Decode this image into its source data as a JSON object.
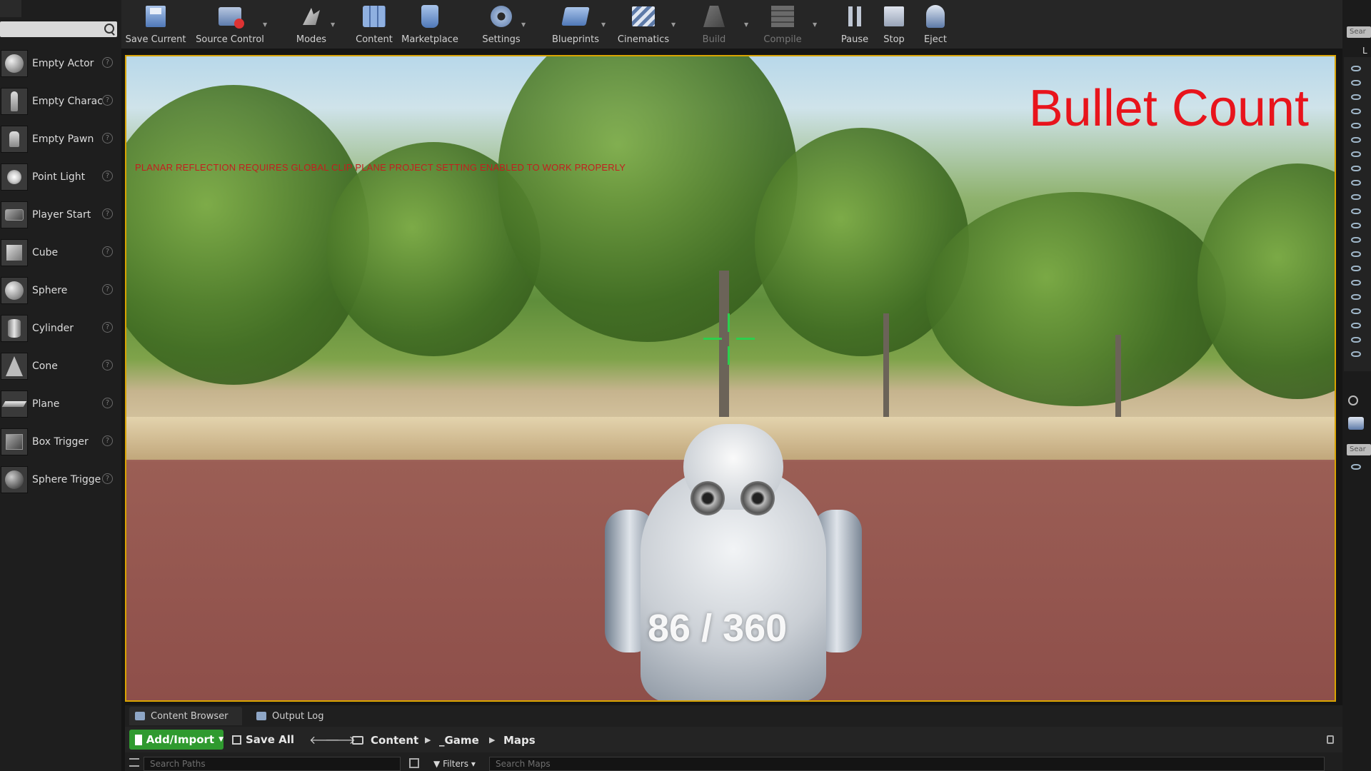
{
  "toolbar": {
    "buttons": [
      {
        "label": "Save Current",
        "icon": "save-icon"
      },
      {
        "label": "Source Control",
        "icon": "source-control-icon"
      },
      {
        "label": "Modes",
        "icon": "modes-icon"
      },
      {
        "label": "Content",
        "icon": "content-icon"
      },
      {
        "label": "Marketplace",
        "icon": "marketplace-icon"
      },
      {
        "label": "Settings",
        "icon": "settings-icon"
      },
      {
        "label": "Blueprints",
        "icon": "blueprints-icon"
      },
      {
        "label": "Cinematics",
        "icon": "cinematics-icon"
      },
      {
        "label": "Build",
        "icon": "build-icon"
      },
      {
        "label": "Compile",
        "icon": "compile-icon"
      },
      {
        "label": "Pause",
        "icon": "pause-icon"
      },
      {
        "label": "Stop",
        "icon": "stop-icon"
      },
      {
        "label": "Eject",
        "icon": "eject-icon"
      }
    ]
  },
  "place_actors": {
    "items": [
      {
        "label": "Empty Actor",
        "icon": "empty-actor-icon"
      },
      {
        "label": "Empty Charac",
        "icon": "empty-character-icon"
      },
      {
        "label": "Empty Pawn",
        "icon": "empty-pawn-icon"
      },
      {
        "label": "Point Light",
        "icon": "point-light-icon"
      },
      {
        "label": "Player Start",
        "icon": "player-start-icon"
      },
      {
        "label": "Cube",
        "icon": "cube-icon"
      },
      {
        "label": "Sphere",
        "icon": "sphere-icon"
      },
      {
        "label": "Cylinder",
        "icon": "cylinder-icon"
      },
      {
        "label": "Cone",
        "icon": "cone-icon"
      },
      {
        "label": "Plane",
        "icon": "plane-icon"
      },
      {
        "label": "Box Trigger",
        "icon": "box-trigger-icon"
      },
      {
        "label": "Sphere Trigge",
        "icon": "sphere-trigger-icon"
      }
    ],
    "help_glyph": "?"
  },
  "viewport": {
    "warning": "PLANAR REFLECTION REQUIRES GLOBAL CLIP PLANE PROJECT SETTING ENABLED TO WORK PROPERLY",
    "overlay_title": "Bullet Count",
    "ammo_text": "86 / 360",
    "border_color": "#d9a400",
    "crosshair_color": "#2ccf4d",
    "title_color": "#e8141c"
  },
  "right_panel": {
    "search_placeholder_1": "Sear",
    "search_placeholder_2": "Sear",
    "tab_letter": "L"
  },
  "content_browser": {
    "tabs": [
      "Content Browser",
      "Output Log"
    ],
    "add_import_label": "Add/Import",
    "save_all_label": "Save All",
    "breadcrumb": [
      "Content",
      "_Game",
      "Maps"
    ],
    "search_paths_placeholder": "Search Paths",
    "filters_label": "Filters",
    "search_maps_placeholder": "Search Maps"
  }
}
